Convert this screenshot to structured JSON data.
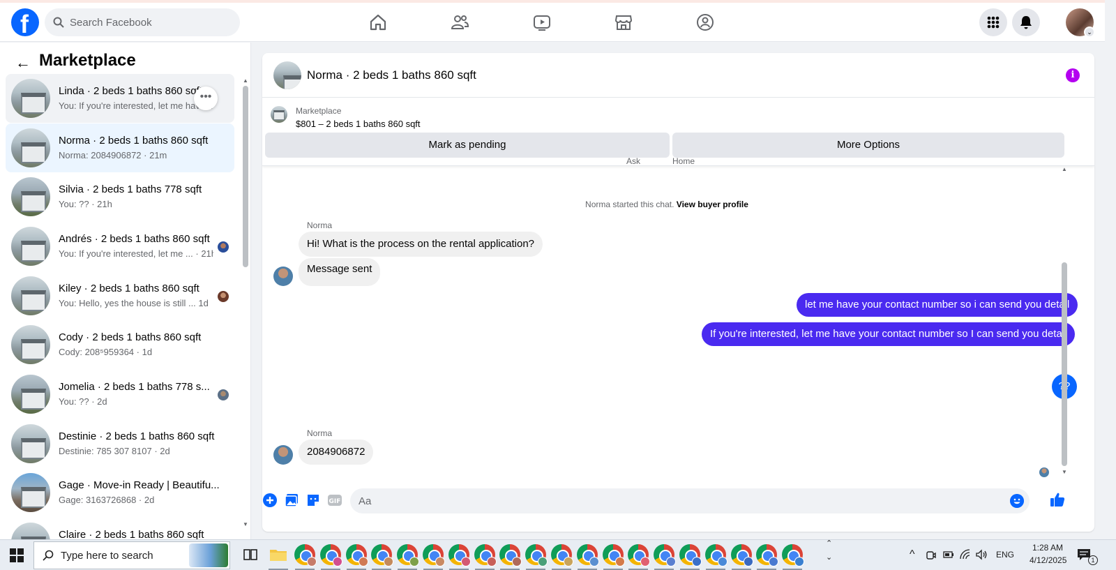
{
  "topbar": {
    "logo": "f",
    "search_placeholder": "Search Facebook",
    "nav_icons": [
      "home-icon",
      "friends-icon",
      "video-icon",
      "marketplace-icon",
      "groups-icon"
    ],
    "right_icons": [
      "menu-grid-icon",
      "bell-icon",
      "profile-avatar"
    ]
  },
  "sidebar": {
    "title": "Marketplace",
    "conversations": [
      {
        "name": "Linda · 2 beds 1 baths 860 sqft",
        "snippet": "You: If you're interested, let me have ·m"
      },
      {
        "name": "Norma · 2 beds 1 baths 860 sqft",
        "snippet": "Norma: 2084906872 · 21m"
      },
      {
        "name": "Silvia · 2 beds 1 baths 778 sqft",
        "snippet": "You: ?? · 21h"
      },
      {
        "name": "Andrés · 2 beds 1 baths 860 sqft",
        "snippet": "You: If you're interested, let me ... · 21h"
      },
      {
        "name": "Kiley · 2 beds 1 baths 860 sqft",
        "snippet": "You: Hello, yes the house is still ...   1d"
      },
      {
        "name": "Cody · 2 beds 1 baths 860 sqft",
        "snippet": "Cody: 208⁵959364 · 1d"
      },
      {
        "name": "Jomelia · 2 beds 1 baths 778 s...",
        "snippet": "You: ?? · 2d"
      },
      {
        "name": "Destinie · 2 beds 1 baths 860 sqft",
        "snippet": "Destinie: 785 307 8107 · 2d"
      },
      {
        "name": "Gage · Move-in Ready | Beautifu...",
        "snippet": "Gage: 3163726868 · 2d"
      },
      {
        "name": "Claire · 2 beds 1 baths 860 sqft",
        "snippet": ""
      }
    ]
  },
  "chat": {
    "title": "Norma · 2 beds 1 baths 860 sqft",
    "listing_source": "Marketplace",
    "listing_price": "$801 – 2 beds 1 baths 860 sqft",
    "mark_pending": "Mark as pending",
    "more_options": "More Options",
    "ghost_left": "Ask",
    "ghost_right": "Home",
    "system_text": "Norma started this chat.",
    "system_link": "View buyer profile",
    "sender_name": "Norma",
    "messages": {
      "in1": "Hi! What is the process on the rental application?",
      "in2": "Message sent",
      "out1": "let me have your contact number so i can send you detail",
      "out2": "If you're interested,  let me have your contact number so I can send you detail",
      "out3": "??",
      "in3": "2084906872"
    },
    "composer_placeholder": "Aa"
  },
  "taskbar": {
    "search_placeholder": "Type here to search",
    "language": "ENG",
    "time": "1:28 AM",
    "date": "4/12/2025",
    "notification_count": "1"
  }
}
